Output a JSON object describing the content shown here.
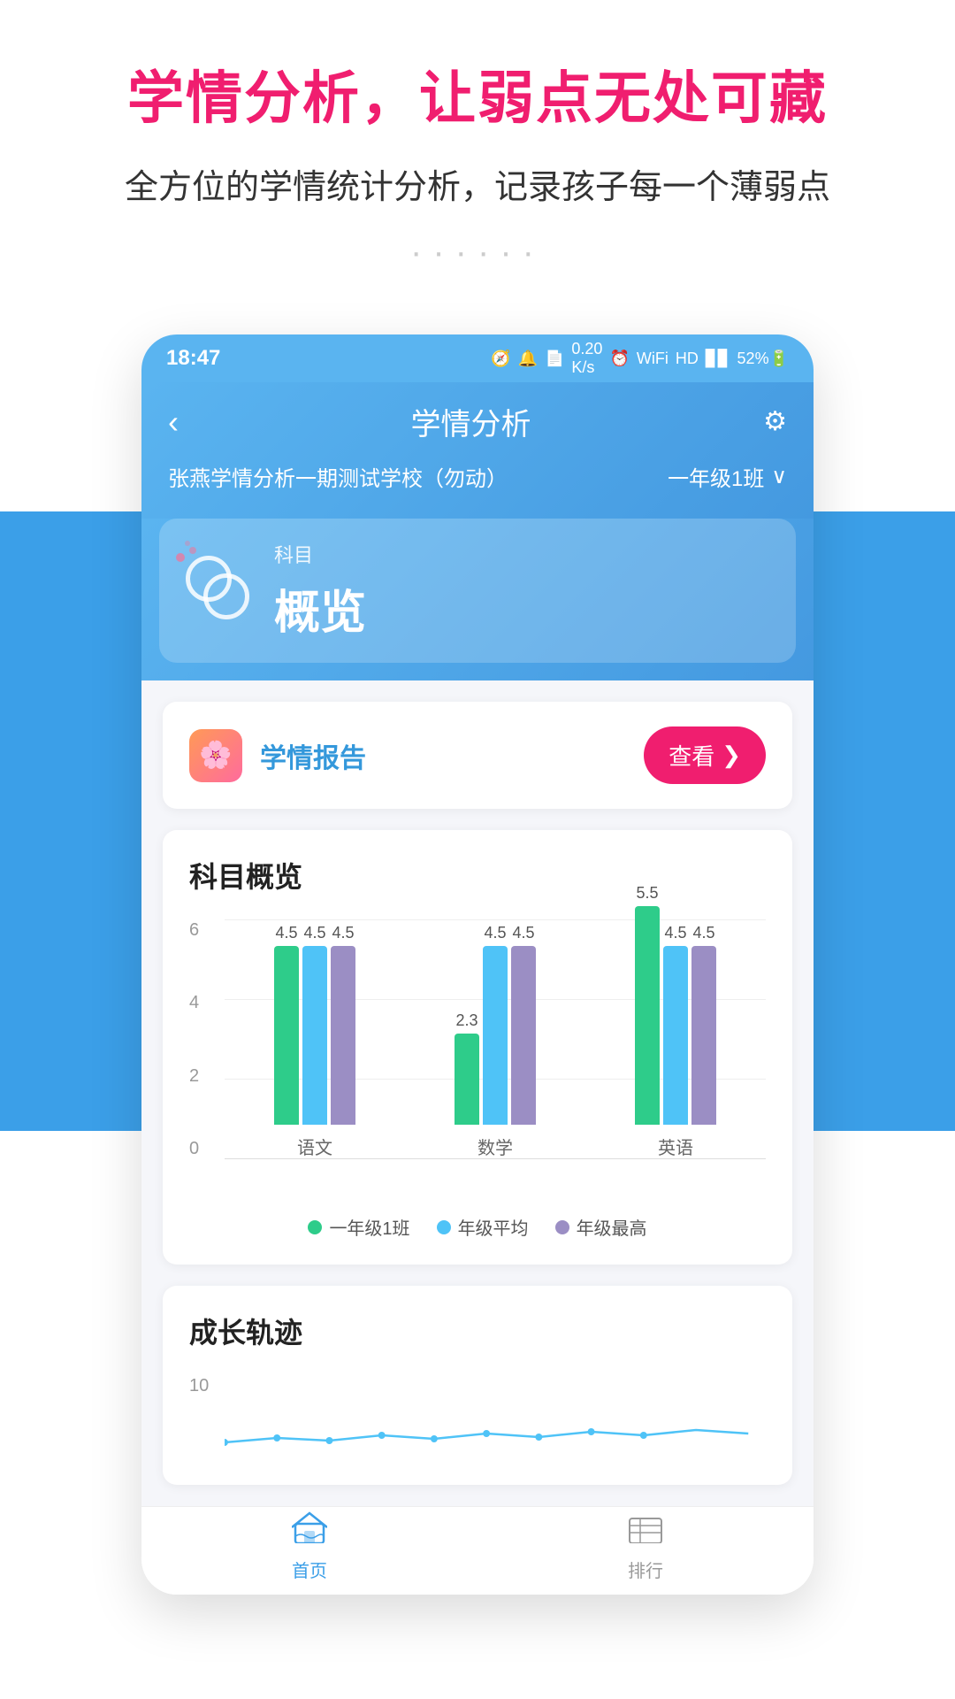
{
  "page": {
    "main_title": "学情分析，让弱点无处可藏",
    "sub_title": "全方位的学情统计分析，记录孩子每一个薄弱点",
    "dots": "······"
  },
  "status_bar": {
    "time": "18:47",
    "right_info": "0.20 K/s  52%"
  },
  "header": {
    "back_label": "‹",
    "title": "学情分析",
    "school_name": "张燕学情分析一期测试学校（勿动）",
    "class_name": "一年级1班",
    "class_arrow": "∨"
  },
  "subject_card": {
    "label_top": "科目",
    "main_text": "概览"
  },
  "report_card": {
    "label": "学情报告",
    "view_btn": "查看",
    "view_icon": "❯"
  },
  "chart": {
    "title": "科目概览",
    "y_labels": [
      "0",
      "2",
      "4",
      "6"
    ],
    "max_val": 6,
    "groups": [
      {
        "label": "语文",
        "bars": [
          {
            "value": 4.5,
            "label": "4.5",
            "color": "green"
          },
          {
            "value": 4.5,
            "label": "4.5",
            "color": "blue"
          },
          {
            "value": 4.5,
            "label": "4.5",
            "color": "purple"
          }
        ]
      },
      {
        "label": "数学",
        "bars": [
          {
            "value": 2.3,
            "label": "2.3",
            "color": "green"
          },
          {
            "value": 4.5,
            "label": "4.5",
            "color": "blue"
          },
          {
            "value": 4.5,
            "label": "4.5",
            "color": "purple"
          }
        ]
      },
      {
        "label": "英语",
        "bars": [
          {
            "value": 5.5,
            "label": "5.5",
            "color": "green"
          },
          {
            "value": 4.5,
            "label": "4.5",
            "color": "blue"
          },
          {
            "value": 4.5,
            "label": "4.5",
            "color": "purple"
          }
        ]
      }
    ],
    "legend": [
      {
        "label": "一年级1班",
        "color": "#2ecc8a"
      },
      {
        "label": "年级平均",
        "color": "#4fc3f7"
      },
      {
        "label": "年级最高",
        "color": "#9b8ec4"
      }
    ]
  },
  "growth": {
    "title": "成长轨迹",
    "y_max": "10"
  },
  "bottom_nav": {
    "items": [
      {
        "label": "首页",
        "active": true
      },
      {
        "label": "排行",
        "active": false
      }
    ]
  }
}
